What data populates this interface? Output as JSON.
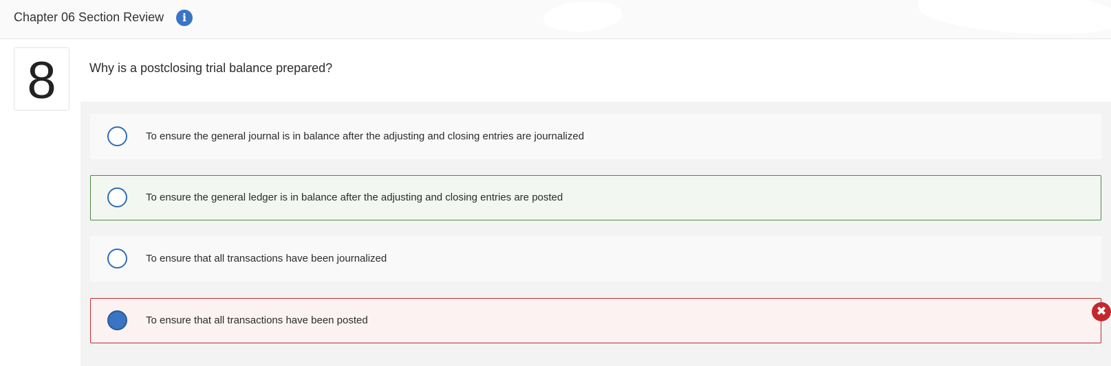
{
  "header": {
    "title": "Chapter 06 Section Review",
    "info_icon": "info-icon",
    "info_glyph": "i"
  },
  "question": {
    "number": "8",
    "text": "Why is a postclosing trial balance prepared?"
  },
  "options": [
    {
      "label": "To ensure the general journal is in balance after the adjusting and closing entries are journalized",
      "state": "default",
      "selected": false
    },
    {
      "label": "To ensure the general ledger is in balance after the adjusting and closing entries are posted",
      "state": "correct",
      "selected": false
    },
    {
      "label": "To ensure that all transactions have been journalized",
      "state": "default",
      "selected": false
    },
    {
      "label": "To ensure that all transactions have been posted",
      "state": "incorrect",
      "selected": true
    }
  ],
  "status": {
    "incorrect_icon": "x-circle-icon",
    "incorrect_glyph": "✖"
  },
  "colors": {
    "accent": "#3a74c4",
    "correct_border": "#4b8a3e",
    "incorrect_border": "#c4282c"
  }
}
